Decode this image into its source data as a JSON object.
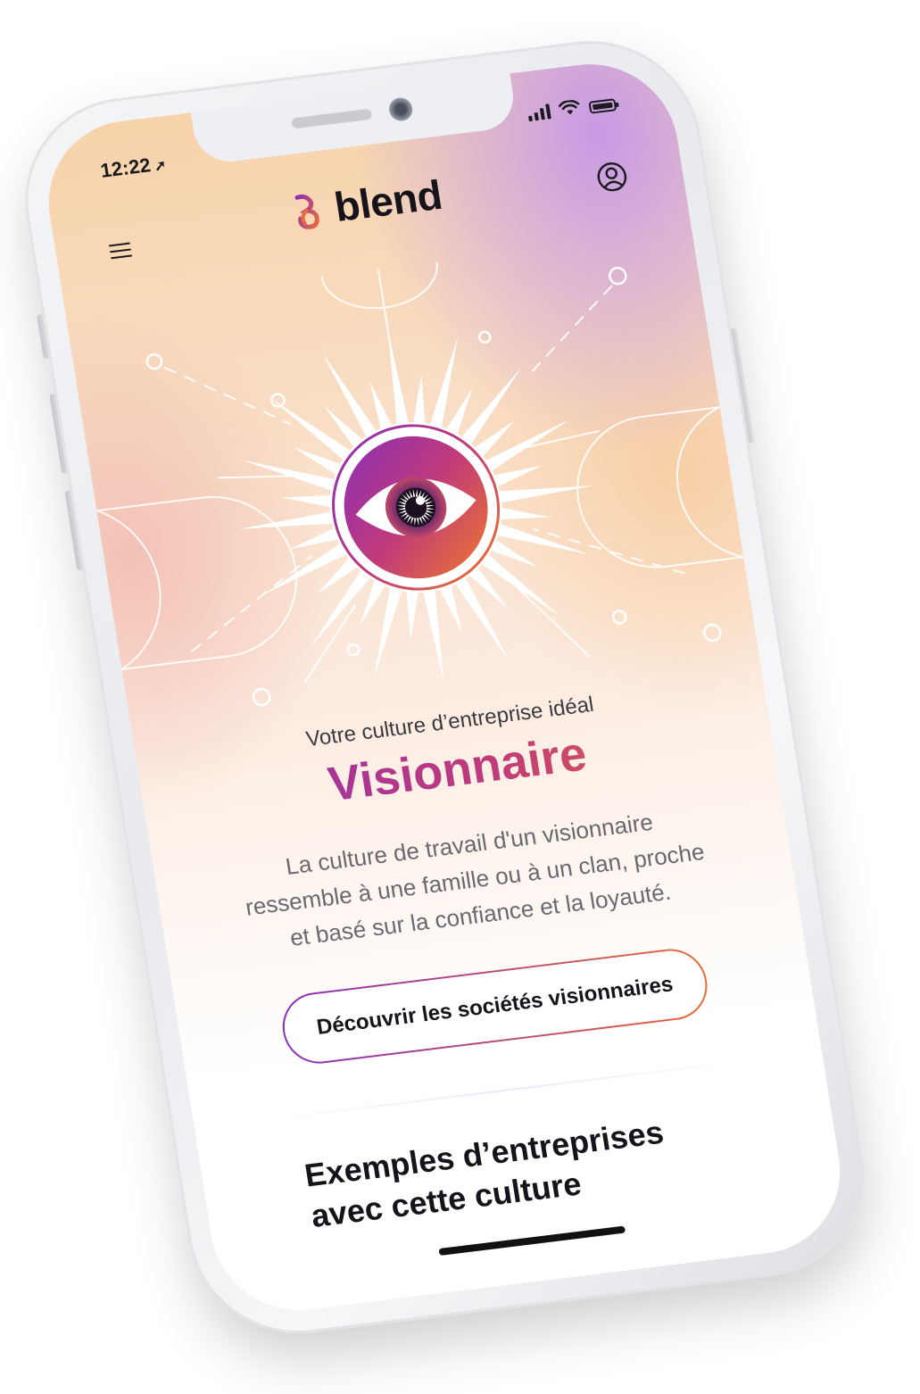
{
  "status_bar": {
    "time": "12:22",
    "location_arrow": "➚",
    "signal_icon": "cellular-signal-icon",
    "wifi_icon": "wifi-icon",
    "battery_icon": "battery-icon"
  },
  "header": {
    "menu_icon": "hamburger-menu-icon",
    "brand_name": "blend",
    "account_icon": "user-account-icon"
  },
  "hero": {
    "illustration_icon": "eye-icon",
    "colors": {
      "gradient_start": "#8a2fb8",
      "gradient_mid": "#c03a7a",
      "gradient_end": "#e86d3a"
    }
  },
  "result": {
    "kicker": "Votre culture d’entreprise idéal",
    "culture_name": "Visionnaire",
    "description": "La culture de travail d'un visionnaire ressemble à une famille ou à un clan, proche et basé sur la confiance et la loyauté.",
    "cta_label": "Découvrir les sociétés visionnaires"
  },
  "examples": {
    "title": "Exemples d’entreprises avec cette culture"
  }
}
